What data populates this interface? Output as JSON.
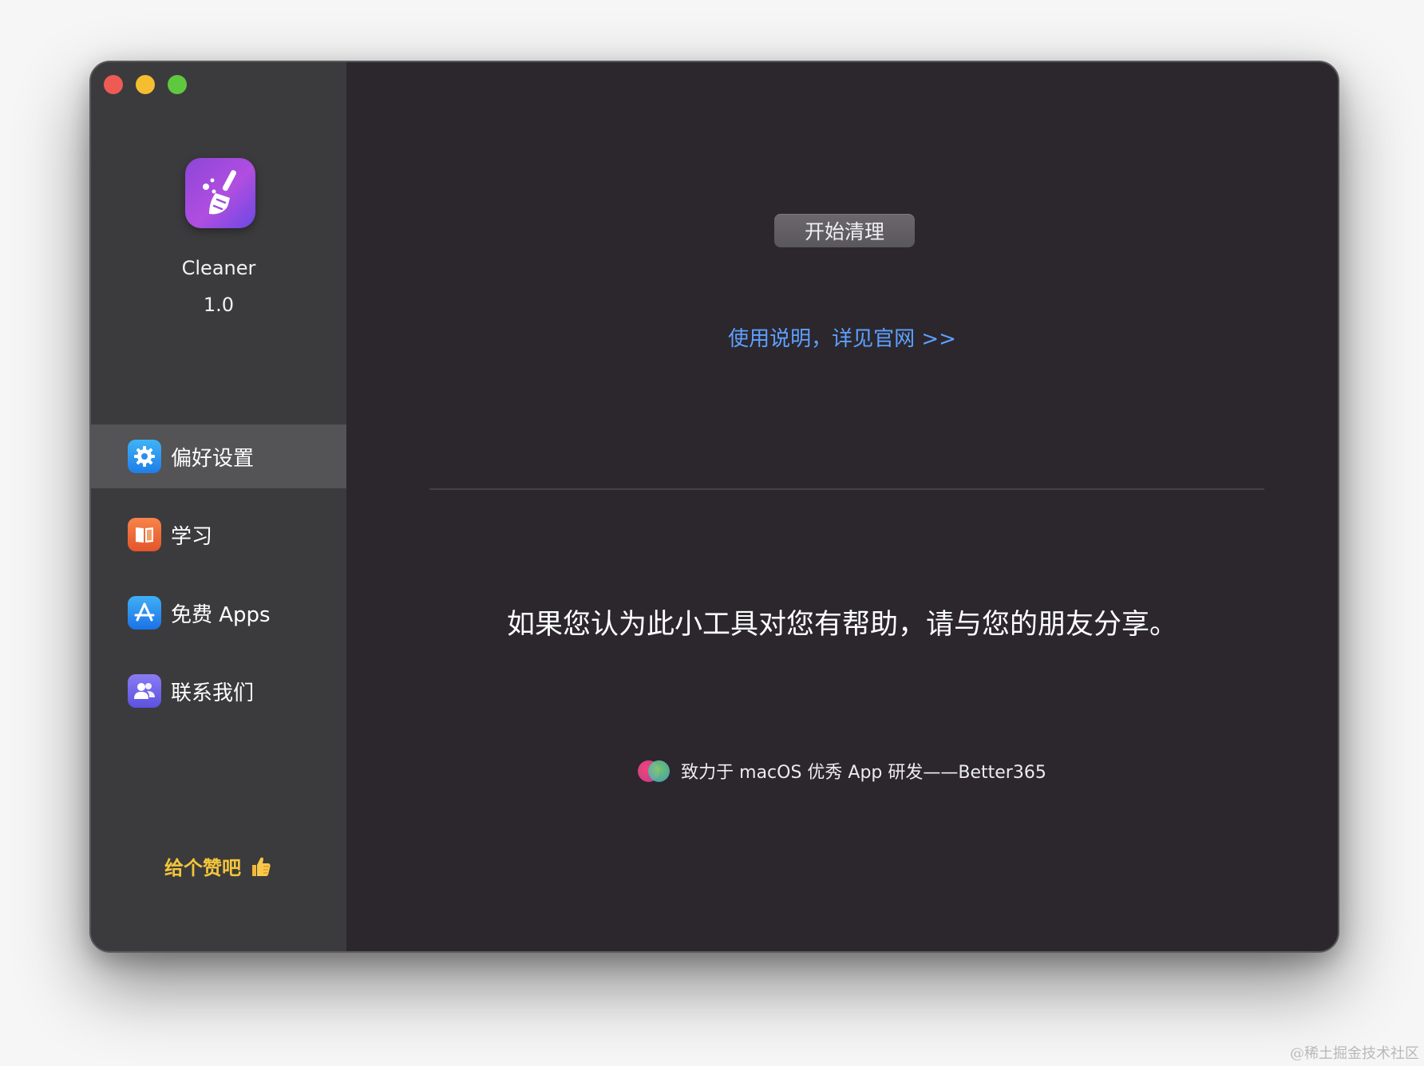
{
  "sidebar": {
    "app_name": "Cleaner",
    "app_version": "1.0",
    "items": [
      {
        "label": "偏好设置",
        "icon": "gear-icon",
        "active": true
      },
      {
        "label": "学习",
        "icon": "book-icon",
        "active": false
      },
      {
        "label": "免费 Apps",
        "icon": "app-store-icon",
        "active": false
      },
      {
        "label": "联系我们",
        "icon": "contacts-icon",
        "active": false
      }
    ],
    "like_text": "给个赞吧"
  },
  "main": {
    "start_button": "开始清理",
    "doc_link": "使用说明，详见官网 >>",
    "share_text": "如果您认为此小工具对您有帮助，请与您的朋友分享。",
    "footer_text": "致力于 macOS 优秀 App 研发——Better365"
  },
  "watermark": "@稀土掘金技术社区",
  "colors": {
    "sidebar_bg": "#3b3b3d",
    "main_bg": "#2b272d",
    "active_item_bg": "#545356",
    "link": "#5ea0ff",
    "like_text": "#f3c53a"
  }
}
